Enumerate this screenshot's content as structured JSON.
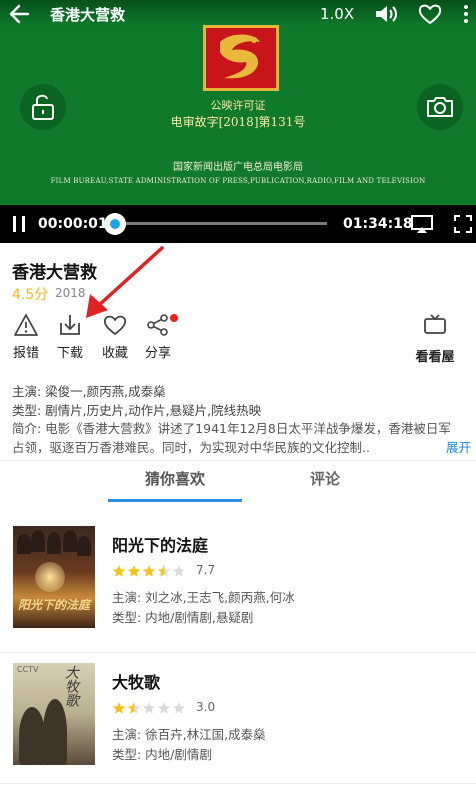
{
  "player": {
    "title": "香港大营救",
    "speed": "1.0X",
    "certificate_line1": "公映许可证",
    "certificate_line2": "电审故字[2018]第131号",
    "bureau_cn": "国家新闻出版广电总局电影局",
    "bureau_en": "FILM BUREAU,STATE ADMINISTRATION OF PRESS,PUBLICATION,RADIO,FILM AND TELEVISION",
    "current_time": "00:00:01",
    "total_time": "01:34:18",
    "progress_fraction": 0.0,
    "accent_color": "#1aa6e8",
    "background_color": "#0f7a2b",
    "icons": [
      "back-icon",
      "volume-icon",
      "heart-icon",
      "more-icon",
      "unlock-icon",
      "camera-icon",
      "pause-icon",
      "cast-icon",
      "fullscreen-icon"
    ]
  },
  "info": {
    "title": "香港大营救",
    "score": "4.5分",
    "year": "2018",
    "actions": [
      {
        "label": "报错",
        "icon": "warning-icon"
      },
      {
        "label": "下载",
        "icon": "download-icon"
      },
      {
        "label": "收藏",
        "icon": "heart-icon"
      },
      {
        "label": "分享",
        "icon": "share-icon"
      }
    ],
    "site_label": "看看屋",
    "cast": "主演: 梁俊一,颜丙燕,成泰燊",
    "genre": "类型: 剧情片,历史片,动作片,悬疑片,院线热映",
    "intro": "简介: 电影《香港大营救》讲述了1941年12月8日太平洋战争爆发，香港被日军占领，驱逐百万香港难民。同时，为实现对中华民族的文化控制..",
    "expand": "展开"
  },
  "tabs": {
    "guess": "猜你喜欢",
    "comment": "评论",
    "active_color": "#2e8ee0"
  },
  "movies": [
    {
      "title": "阳光下的法庭",
      "rating": "7.7",
      "stars": 3.5,
      "poster_text": "阳光下的法庭",
      "cast": "主演: 刘之冰,王志飞,颜丙燕,何冰",
      "genre": "类型: 内地/剧情剧,悬疑剧"
    },
    {
      "title": "大牧歌",
      "rating": "3.0",
      "stars": 1.5,
      "poster_text": "大牧歌",
      "poster_corner": "CCTV",
      "cast": "主演: 徐百卉,林江国,成泰燊",
      "genre": "类型: 内地/剧情剧"
    }
  ],
  "star_color": "#f5c318"
}
